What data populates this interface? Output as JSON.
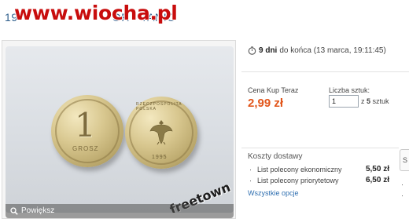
{
  "watermark": {
    "text": "www.wiocha.pl"
  },
  "listing": {
    "title_prefix": "19",
    "title_suffix": "ÓR - TANIO"
  },
  "photo": {
    "coin_left": {
      "denomination": "1",
      "label": "GROSZ"
    },
    "coin_right": {
      "ring_text": "RZECZPOSPOLITA POLSKA",
      "year": "1995"
    },
    "seller_watermark": "freetown",
    "zoom_label": "Powiększ",
    "zoom_icon": "magnifier-icon"
  },
  "auction": {
    "timer_icon": "stopwatch-icon",
    "days": "9 dni",
    "ends_text": "do końca (13 marca, 19:11:45)"
  },
  "buy_now": {
    "price_label": "Cena Kup Teraz",
    "price": "2,99 zł",
    "price_color": "#e2561b"
  },
  "quantity": {
    "label": "Liczba sztuk:",
    "value": "1",
    "of_prefix": "z",
    "available": "5",
    "unit": "sztuk"
  },
  "shipping": {
    "title": "Koszty dostawy",
    "options": [
      {
        "bullet": "·",
        "name": "List polecony ekonomiczny",
        "cost": "5,50 zł"
      },
      {
        "bullet": "·",
        "name": "List polecony priorytetowy",
        "cost": "6,50 zł"
      }
    ],
    "all_options_link": "Wszystkie opcje"
  },
  "side": {
    "box_text": "S",
    "bullets": [
      "·",
      "·"
    ]
  }
}
